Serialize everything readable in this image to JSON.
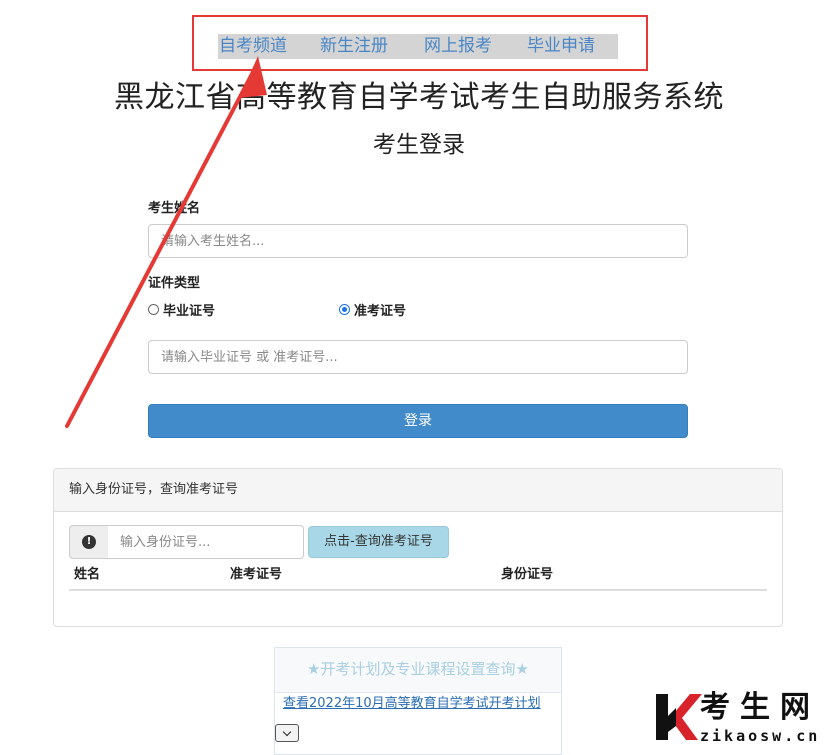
{
  "nav": {
    "items": [
      {
        "label": "自考频道"
      },
      {
        "label": "新生注册"
      },
      {
        "label": "网上报考"
      },
      {
        "label": "毕业申请"
      }
    ]
  },
  "header": {
    "title": "黑龙江省高等教育自学考试考生自助服务系统",
    "subtitle": "考生登录"
  },
  "login_form": {
    "name_label": "考生姓名",
    "name_placeholder": "请输入考生姓名...",
    "id_type_label": "证件类型",
    "radio_options": [
      {
        "label": "毕业证号",
        "checked": false
      },
      {
        "label": "准考证号",
        "checked": true
      }
    ],
    "number_placeholder": "请输入毕业证号 或 准考证号...",
    "login_label": "登录"
  },
  "lookup_panel": {
    "heading": "输入身份证号，查询准考证号",
    "alert_icon": "exclamation-circle-icon",
    "id_placeholder": "输入身份证号...",
    "query_label": "点击-查询准考证号",
    "columns": [
      "姓名",
      "准考证号",
      "身份证号"
    ]
  },
  "plan": {
    "title": "★开考计划及专业课程设置查询★",
    "link": "查看2022年10月高等教育自学考试开考计划"
  },
  "watermark": {
    "text": "考生网",
    "url": "zikaosw.cn"
  },
  "colors": {
    "annotation": "#e53935",
    "link": "#4a86c5",
    "primary_button": "#428bca",
    "info_button": "#a8d8e8"
  }
}
